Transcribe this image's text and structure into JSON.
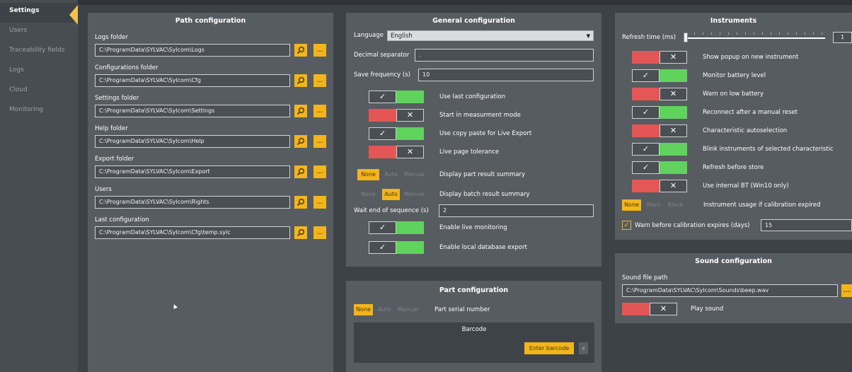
{
  "sidebar": {
    "items": [
      {
        "label": "Settings"
      },
      {
        "label": "Users"
      },
      {
        "label": "Traceability fields"
      },
      {
        "label": "Logs"
      },
      {
        "label": "Cloud"
      },
      {
        "label": "Monitoring"
      }
    ]
  },
  "path_config": {
    "title": "Path configuration",
    "browse_icon": "search-icon",
    "more_label": "...",
    "folders": [
      {
        "label": "Logs folder",
        "value": "C:\\ProgramData\\SYLVAC\\Sylcom\\Logs"
      },
      {
        "label": "Configurations folder",
        "value": "C:\\ProgramData\\SYLVAC\\Sylcom\\Cfg"
      },
      {
        "label": "Settings folder",
        "value": "C:\\ProgramData\\SYLVAC\\Sylcom\\Settings"
      },
      {
        "label": "Help folder",
        "value": "C:\\ProgramData\\SYLVAC\\Sylcom\\Help"
      },
      {
        "label": "Export folder",
        "value": "C:\\ProgramData\\SYLVAC\\Sylcom\\Export"
      },
      {
        "label": "Users",
        "value": "C:\\ProgramData\\SYLVAC\\Sylcom\\Rights"
      },
      {
        "label": "Last configuration",
        "value": "C:\\ProgramData\\SYLVAC\\Sylcom\\Cfg\\temp.sylc"
      }
    ]
  },
  "general_config": {
    "title": "General configuration",
    "language_label": "Language",
    "language_value": "English",
    "decimal_label": "Decimal separator",
    "decimal_value": ".",
    "save_freq_label": "Save frequency (s)",
    "save_freq_value": "10",
    "toggles": [
      {
        "label": "Use last configuration",
        "on": true
      },
      {
        "label": "Start in measurment mode",
        "on": false
      },
      {
        "label": "Use copy paste for  Live Export",
        "on": true
      },
      {
        "label": "Live page tolerance",
        "on": false
      }
    ],
    "seg_options": [
      "None",
      "Auto",
      "Manual"
    ],
    "part_summary_label": "Display part result summary",
    "part_summary_selected": "None",
    "batch_summary_label": "Display batch result summary",
    "batch_summary_selected": "Auto",
    "wait_label": "Wait end of sequence (s)",
    "wait_value": "2",
    "toggles2": [
      {
        "label": "Enable live monitoring",
        "on": true
      },
      {
        "label": "Enable local database export",
        "on": true
      }
    ]
  },
  "part_config": {
    "title": "Part configuration",
    "seg_options": [
      "None",
      "Auto",
      "Manual"
    ],
    "selected": "None",
    "serial_label": "Part serial number",
    "barcode_title": "Barcode",
    "enter_barcode": "Enter barcode",
    "clear_label": "x"
  },
  "instruments": {
    "title": "Instruments",
    "refresh_label": "Refresh time (ms)",
    "refresh_value": "1",
    "toggles": [
      {
        "label": "Show popup on new instrument",
        "on": false
      },
      {
        "label": "Monitor battery level",
        "on": true
      },
      {
        "label": "Warn on low battery",
        "on": false
      },
      {
        "label": "Reconnect after a manual reset",
        "on": true
      },
      {
        "label": "Characteristic autoselection",
        "on": false
      },
      {
        "label": "Blink instruments of selected characteristic",
        "on": true
      },
      {
        "label": "Refresh before store",
        "on": true
      },
      {
        "label": "Use internal BT (Win10 only)",
        "on": false
      }
    ],
    "usage_options": [
      "None",
      "Warn",
      "Block"
    ],
    "usage_selected": "None",
    "usage_label": "Instrument usage if calibration expired",
    "warn_label": "Warn before calibration expires (days)",
    "warn_value": "15"
  },
  "sound": {
    "title": "Sound configuration",
    "path_label": "Sound file path",
    "path_value": "C:\\ProgramData\\SYLVAC\\Sylcom\\Sounds\\beep.wav",
    "more_label": "...",
    "play_label": "Play sound",
    "play_on": false
  },
  "colors": {
    "accent": "#f2b51c",
    "toggle_on": "#5fd35c",
    "toggle_off": "#e45656",
    "panel_bg": "#575c61",
    "sidebar_bg": "#484d52"
  }
}
